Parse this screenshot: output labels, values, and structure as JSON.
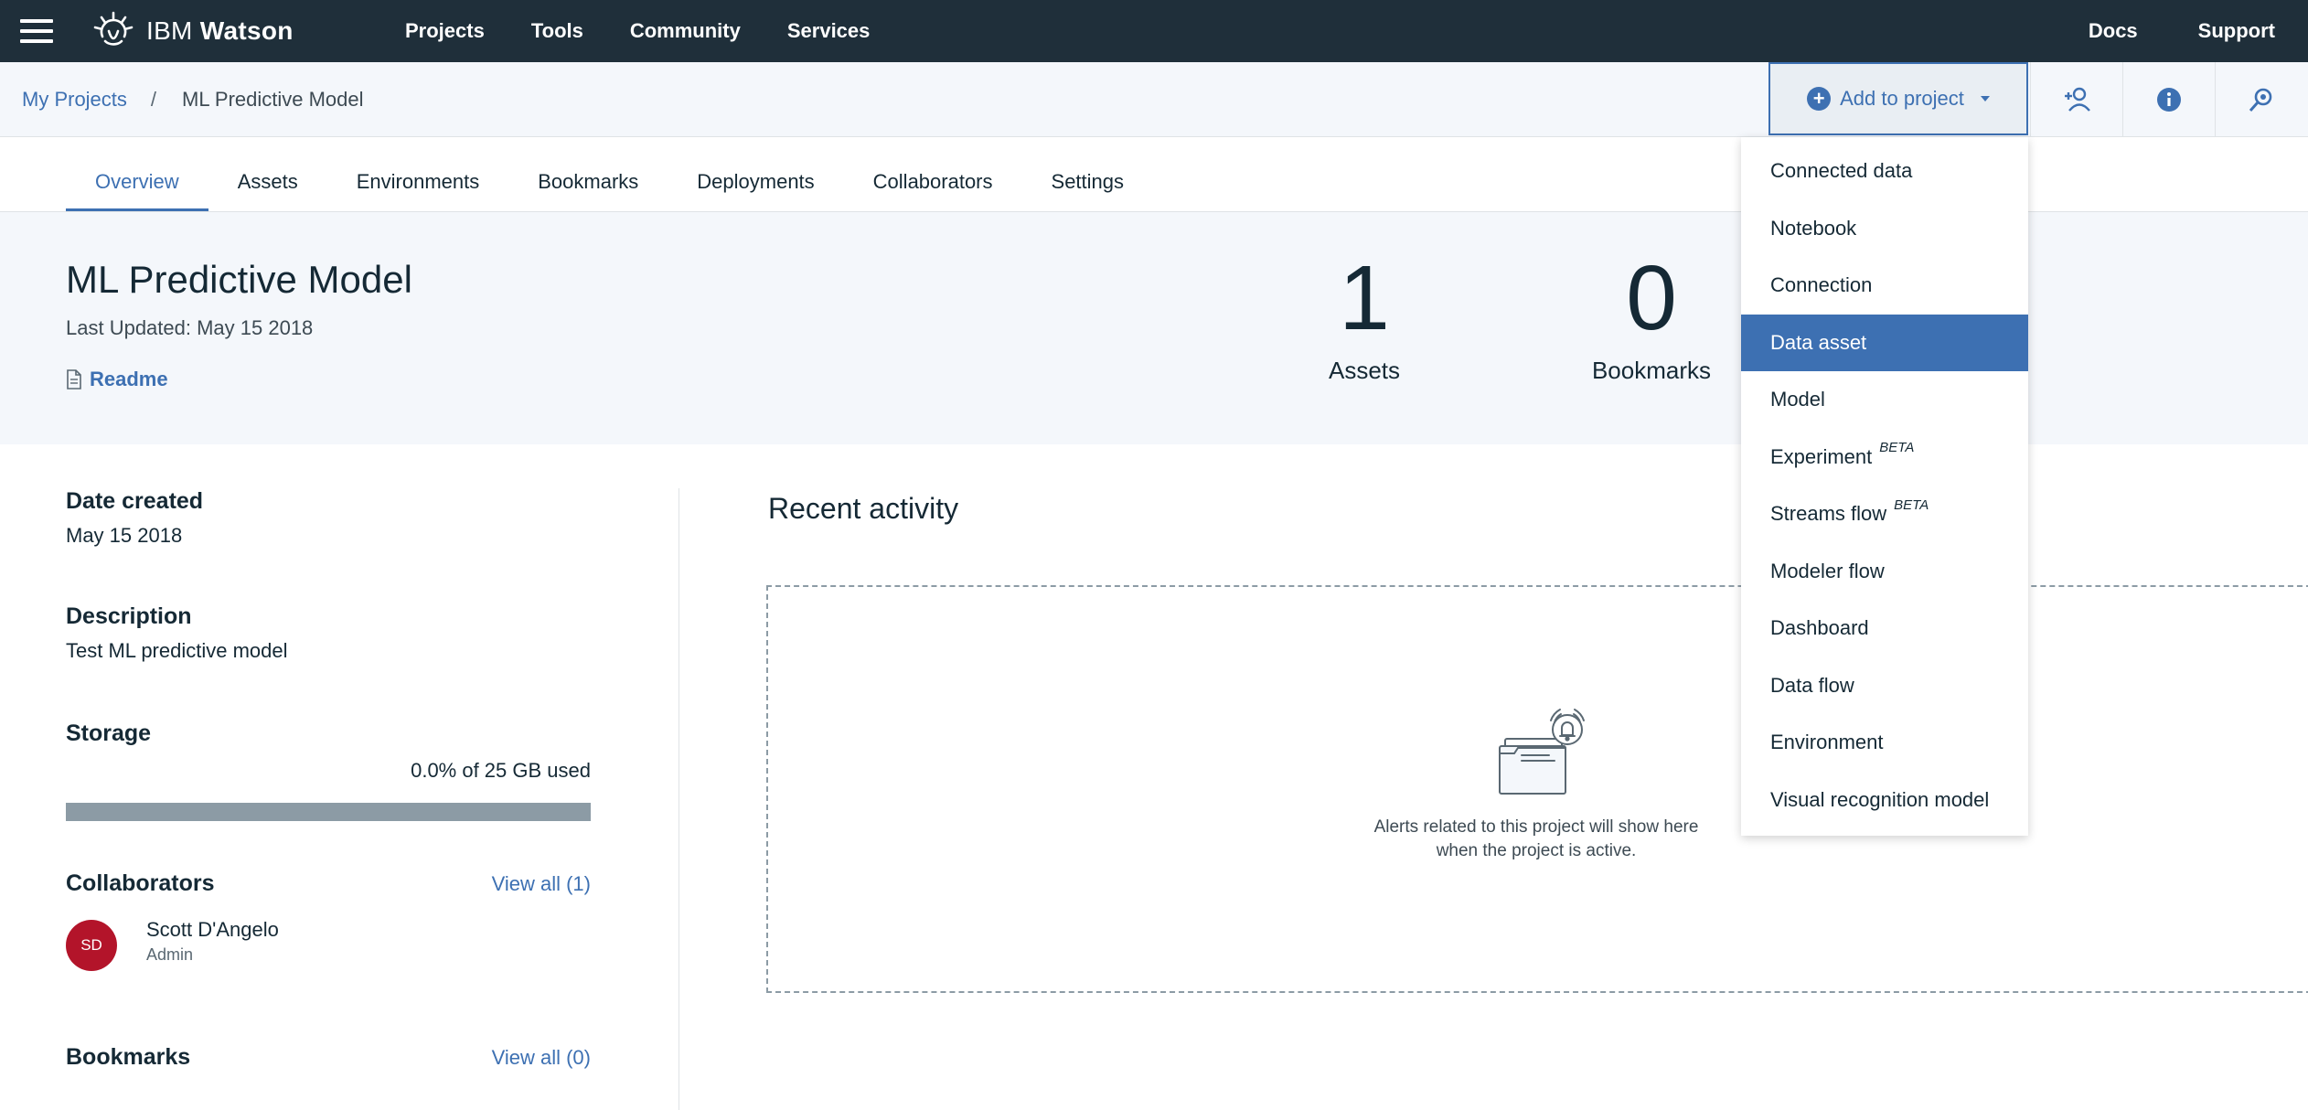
{
  "topbar": {
    "brand_prefix": "IBM",
    "brand_name": "Watson",
    "nav": [
      "Projects",
      "Tools",
      "Community",
      "Services"
    ],
    "right_links": [
      "Docs",
      "Support"
    ]
  },
  "breadcrumb": {
    "parent": "My Projects",
    "separator": "/",
    "current": "ML Predictive Model"
  },
  "add_button": {
    "label": "Add to project"
  },
  "tabs": [
    "Overview",
    "Assets",
    "Environments",
    "Bookmarks",
    "Deployments",
    "Collaborators",
    "Settings"
  ],
  "active_tab": "Overview",
  "project": {
    "title": "ML Predictive Model",
    "last_updated": "Last Updated: May 15 2018",
    "readme_label": "Readme"
  },
  "stats": {
    "assets_count": "1",
    "assets_label": "Assets",
    "bookmarks_count": "0",
    "bookmarks_label": "Bookmarks"
  },
  "details": {
    "date_created_label": "Date created",
    "date_created": "May 15 2018",
    "description_label": "Description",
    "description": "Test ML predictive model",
    "storage_label": "Storage",
    "storage_used": "0.0% of 25 GB used",
    "storage_fraction": 0.0,
    "collaborators_label": "Collaborators",
    "collaborators_view_all": "View all (1)",
    "collaborator": {
      "initials": "SD",
      "name": "Scott D'Angelo",
      "role": "Admin"
    },
    "bookmarks_label": "Bookmarks",
    "bookmarks_view_all": "View all (0)"
  },
  "recent": {
    "title": "Recent activity",
    "empty_line1": "Alerts related to this project will show here",
    "empty_line2": "when the project is active."
  },
  "dropdown": {
    "items": [
      {
        "label": "Connected data",
        "beta": ""
      },
      {
        "label": "Notebook",
        "beta": ""
      },
      {
        "label": "Connection",
        "beta": ""
      },
      {
        "label": "Data asset",
        "beta": ""
      },
      {
        "label": "Model",
        "beta": ""
      },
      {
        "label": "Experiment",
        "beta": "BETA"
      },
      {
        "label": "Streams flow",
        "beta": "BETA"
      },
      {
        "label": "Modeler flow",
        "beta": ""
      },
      {
        "label": "Dashboard",
        "beta": ""
      },
      {
        "label": "Data flow",
        "beta": ""
      },
      {
        "label": "Environment",
        "beta": ""
      },
      {
        "label": "Visual recognition model",
        "beta": ""
      }
    ],
    "selected": "Data asset"
  },
  "colors": {
    "topbar": "#1f2f3a",
    "accent": "#3d70b2",
    "avatar": "#b3142a",
    "panel": "#f4f7fb"
  }
}
